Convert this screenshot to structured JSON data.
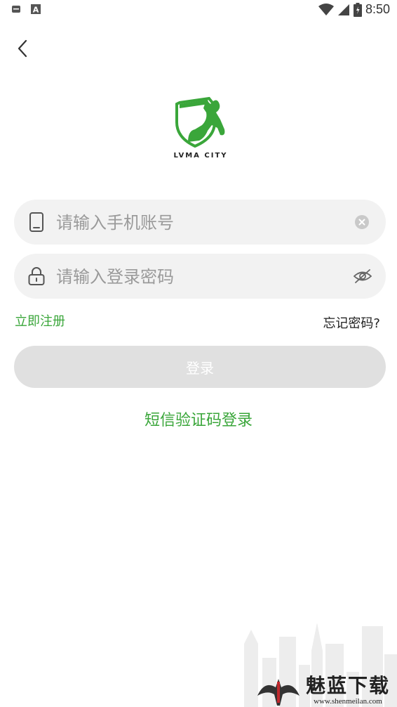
{
  "status_bar": {
    "time": "8:50",
    "icons": [
      "notification-icon",
      "font-app-icon",
      "wifi-icon",
      "signal-icon",
      "battery-icon"
    ]
  },
  "nav": {
    "back_icon": "chevron-left-icon"
  },
  "logo": {
    "text": "LVMA CITY",
    "brand_color": "#3aa63a"
  },
  "form": {
    "phone": {
      "placeholder": "请输入手机账号",
      "value": "",
      "icon": "phone-icon",
      "action_icon": "clear-icon"
    },
    "password": {
      "placeholder": "请输入登录密码",
      "value": "",
      "icon": "lock-icon",
      "action_icon": "eye-hidden-icon"
    }
  },
  "links": {
    "register": "立即注册",
    "forgot": "忘记密码?"
  },
  "login_button": {
    "label": "登录"
  },
  "sms_login": {
    "label": "短信验证码登录"
  },
  "watermark": {
    "title": "魅蓝下载",
    "url": "www.shenmeilan.com"
  },
  "colors": {
    "accent": "#3aa63a",
    "field_bg": "#f2f2f2",
    "button_disabled": "#e0e0e0"
  }
}
